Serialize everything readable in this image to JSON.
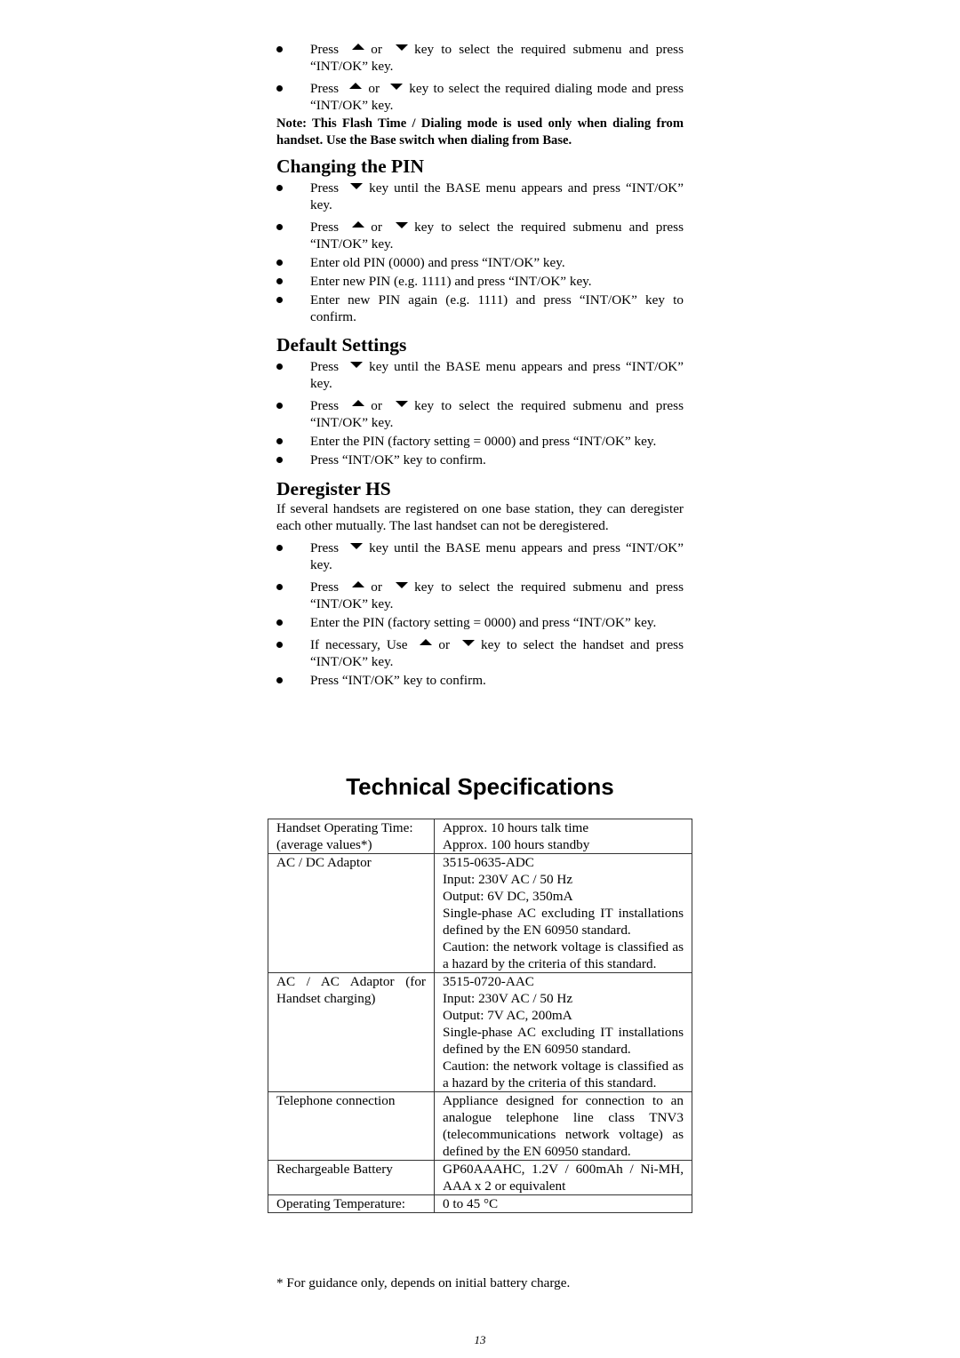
{
  "top_list": [
    {
      "parts": [
        "Press",
        "up",
        "or",
        "down",
        "key to select the required submenu and press “INT/OK” key."
      ]
    },
    {
      "parts": [
        "Press",
        "up",
        "or",
        "down",
        "key to select the required dialing mode and press “INT/OK” key."
      ]
    }
  ],
  "note": "Note: This Flash Time / Dialing mode is used only when dialing from handset.   Use the Base switch when dialing from Base.",
  "sections": {
    "changing_pin": {
      "heading": "Changing the PIN",
      "items": [
        {
          "a": "Press",
          "b": "key until the BASE menu appears and press “INT/OK” key."
        },
        {
          "a": "Press",
          "or": "or",
          "b": "key to select the required submenu and press “INT/OK” key."
        },
        {
          "text": "Enter old PIN (0000) and press “INT/OK” key."
        },
        {
          "text": "Enter new PIN (e.g. 1111) and press “INT/OK” key."
        },
        {
          "text": "Enter new PIN again (e.g. 1111) and press “INT/OK” key to confirm."
        }
      ]
    },
    "default_settings": {
      "heading": "Default Settings",
      "items": [
        {
          "a": "Press",
          "b": "key until the BASE menu appears and press “INT/OK” key."
        },
        {
          "a": "Press",
          "or": "or",
          "b": "key to select the required submenu and press “INT/OK” key."
        },
        {
          "text": "Enter the PIN (factory setting = 0000) and press “INT/OK” key."
        },
        {
          "text": "Press “INT/OK” key to confirm."
        }
      ]
    },
    "deregister": {
      "heading": "Deregister HS",
      "intro": "If several handsets are registered on one base station, they can deregister each other mutually. The last handset can not be deregistered.",
      "items": [
        {
          "a": "Press",
          "b": "key until the BASE menu appears and press “INT/OK” key."
        },
        {
          "a": "Press",
          "or": "or",
          "b": "key to select the required submenu and press “INT/OK” key."
        },
        {
          "text": "Enter the PIN (factory setting = 0000) and press “INT/OK” key."
        },
        {
          "a": "If necessary, Use",
          "or": "or",
          "b": "key to select the handset and press “INT/OK” key."
        },
        {
          "text": "Press “INT/OK” key to confirm."
        }
      ]
    }
  },
  "spec": {
    "title": "Technical Specifications",
    "rows": [
      {
        "key": [
          "Handset Operating Time:",
          "(average values*)"
        ],
        "val": [
          "Approx. 10 hours talk time",
          "Approx. 100 hours standby"
        ]
      },
      {
        "key": [
          "AC / DC Adaptor"
        ],
        "val": [
          "3515-0635-ADC",
          "Input: 230V AC / 50 Hz",
          "Output: 6V DC, 350mA",
          "Single-phase AC excluding IT installations defined by the EN 60950 standard.",
          "Caution: the network voltage is classified as a hazard by the criteria of this standard."
        ]
      },
      {
        "key": [
          "AC / AC Adaptor (for Handset charging)"
        ],
        "val": [
          "3515-0720-AAC",
          "Input: 230V AC / 50 Hz",
          "Output: 7V AC, 200mA",
          "Single-phase AC excluding IT installations defined by the EN 60950 standard.",
          "Caution: the network voltage is classified as a hazard by the criteria of this standard."
        ]
      },
      {
        "key": [
          "Telephone connection"
        ],
        "val": [
          "Appliance designed for connection to an analogue telephone line class TNV3 (telecommunications network voltage) as defined by the EN 60950 standard."
        ]
      },
      {
        "key": [
          "Rechargeable Battery"
        ],
        "val": [
          "GP60AAAHC, 1.2V / 600mAh / Ni-MH, AAA x 2 or equivalent"
        ]
      },
      {
        "key": [
          "Operating Temperature:"
        ],
        "val": [
          "0 to 45 °C"
        ]
      }
    ],
    "footnote": "* For guidance only, depends on initial battery charge."
  },
  "page_number": "13"
}
